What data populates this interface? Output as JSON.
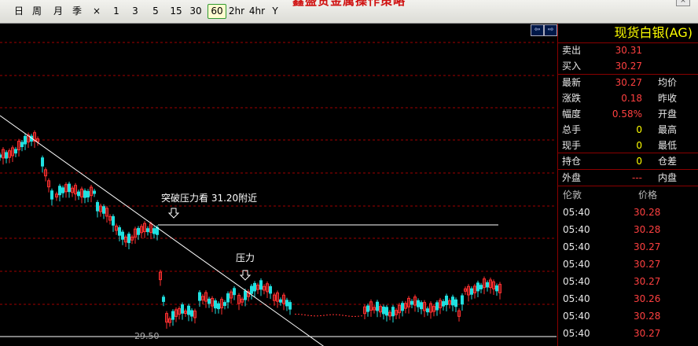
{
  "toolbar": {
    "periods": [
      "日",
      "周",
      "月",
      "季",
      "×",
      "1",
      "3",
      "5",
      "15",
      "30",
      "60",
      "2hr",
      "4hr",
      "Y"
    ],
    "active": "60",
    "banner": "鑫盛贵金属操作策略"
  },
  "panel": {
    "title": "现货白银(AG)",
    "sell_label": "卖出",
    "sell_value": "30.31",
    "buy_label": "买入",
    "buy_value": "30.27",
    "rows": [
      {
        "label": "最新",
        "value": "30.27",
        "value_color": "red",
        "label2": "均价"
      },
      {
        "label": "涨跌",
        "value": "0.18",
        "value_color": "red",
        "label2": "昨收"
      },
      {
        "label": "幅度",
        "value": "0.58%",
        "value_color": "red",
        "label2": "开盘"
      },
      {
        "label": "总手",
        "value": "0",
        "value_color": "yellow",
        "label2": "最高"
      },
      {
        "label": "现手",
        "value": "0",
        "value_color": "yellow",
        "label2": "最低"
      },
      {
        "label": "持仓",
        "value": "0",
        "value_color": "yellow",
        "label2": "仓差"
      }
    ],
    "outer_label": "外盘",
    "outer_value": "---",
    "inner_label": "内盘",
    "tick_header": {
      "time": "伦敦",
      "price": "价格"
    },
    "ticks": [
      {
        "time": "05:40",
        "price": "30.28"
      },
      {
        "time": "05:40",
        "price": "30.28"
      },
      {
        "time": "05:40",
        "price": "30.27"
      },
      {
        "time": "05:40",
        "price": "30.27"
      },
      {
        "time": "05:40",
        "price": "30.27"
      },
      {
        "time": "05:40",
        "price": "30.26"
      },
      {
        "time": "05:40",
        "price": "30.28"
      },
      {
        "time": "05:40",
        "price": "30.27"
      }
    ]
  },
  "chart": {
    "annotation_1": "突破压力看 31.20附近",
    "annotation_2": "压力",
    "low_label": "29.50",
    "colors": {
      "up": "#ff3030",
      "down": "#20e0e0",
      "grid": "#a00000",
      "line": "#ffffff"
    }
  }
}
